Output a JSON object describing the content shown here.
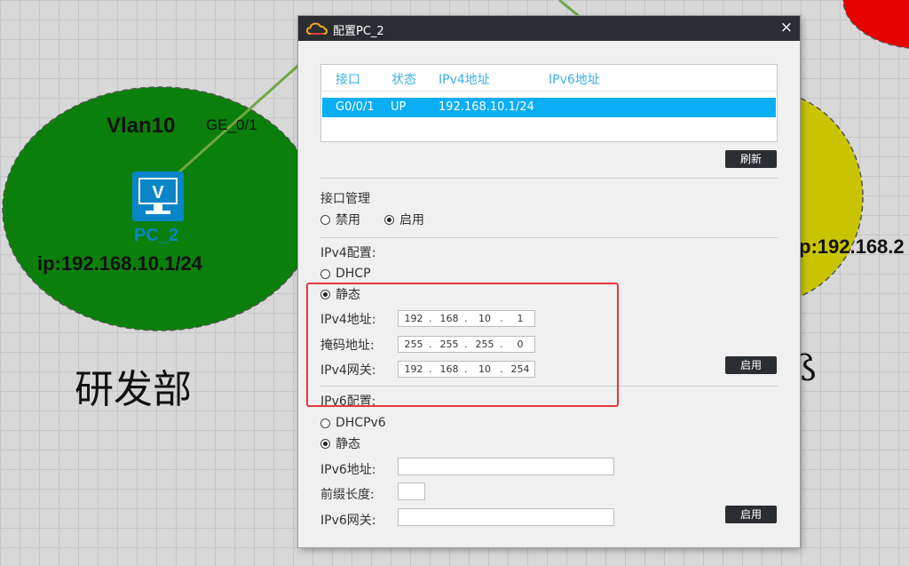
{
  "topology": {
    "vlan_label": "Vlan10",
    "port_label": "GE_0/1",
    "pc_name": "PC_2",
    "pc_ip": "ip:192.168.10.1/24",
    "dept_label": "研发部",
    "right_ip_fragment": "p:192.168.2",
    "right_dept_fragment": "ß",
    "colors": {
      "green_zone": "#0b7f0b",
      "yellow_zone": "#c8c400",
      "red_zone": "#e80000",
      "link": "#6fa843"
    }
  },
  "dialog": {
    "title": "配置PC_2",
    "close_glyph": "×",
    "table": {
      "headers": [
        "接口",
        "状态",
        "IPv4地址",
        "IPv6地址"
      ],
      "rows": [
        {
          "iface": "G0/0/1",
          "status": "UP",
          "ipv4": "192.168.10.1/24",
          "ipv6": ""
        }
      ]
    },
    "refresh_label": "刷新",
    "iface_mgmt": {
      "title": "接口管理",
      "disable_label": "禁用",
      "enable_label": "启用",
      "selected": "enable"
    },
    "ipv4": {
      "title": "IPv4配置:",
      "dhcp_label": "DHCP",
      "static_label": "静态",
      "selected": "static",
      "addr_label": "IPv4地址:",
      "mask_label": "掩码地址:",
      "gw_label": "IPv4网关:",
      "addr": [
        "192",
        "168",
        "10",
        "1"
      ],
      "mask": [
        "255",
        "255",
        "255",
        "0"
      ],
      "gw": [
        "192",
        "168",
        "10",
        "254"
      ],
      "apply_label": "启用"
    },
    "ipv6": {
      "title": "IPv6配置:",
      "dhcp_label": "DHCPv6",
      "static_label": "静态",
      "selected": "static",
      "addr_label": "IPv6地址:",
      "prefix_label": "前缀长度:",
      "gw_label": "IPv6网关:",
      "addr": "",
      "prefix": "",
      "gw": "",
      "apply_label": "启用"
    },
    "colors": {
      "titlebar": "#2a2d31",
      "header_text": "#3bb0e6",
      "selected_row": "#0aaef5",
      "highlight": "#e5383b"
    }
  }
}
